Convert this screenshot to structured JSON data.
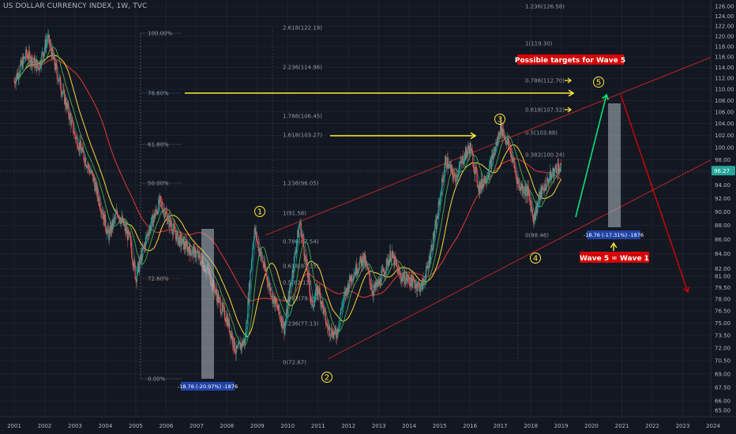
{
  "header": {
    "title": "US DOLLAR CURRENCY INDEX, 1W, TVC"
  },
  "chart_data": {
    "type": "candlestick",
    "title": "US DOLLAR CURRENCY INDEX, 1W, TVC",
    "x_ticks": [
      "2001",
      "2002",
      "2003",
      "2004",
      "2005",
      "2006",
      "2007",
      "2008",
      "2009",
      "2010",
      "2011",
      "2012",
      "2013",
      "2014",
      "2015",
      "2016",
      "2017",
      "2018",
      "2019",
      "2020",
      "2021",
      "2022",
      "2023",
      "2024"
    ],
    "y_ticks": [
      "126.00",
      "124.00",
      "122.00",
      "120.00",
      "118.00",
      "116.00",
      "114.00",
      "112.00",
      "110.00",
      "108.00",
      "106.00",
      "104.00",
      "102.00",
      "100.00",
      "98.00",
      "96.00",
      "94.00",
      "92.00",
      "90.00",
      "88.00",
      "86.00",
      "84.00",
      "82.00",
      "81.00",
      "79.50",
      "78.00",
      "76.50",
      "75.00",
      "73.50",
      "72.00",
      "70.50",
      "69.00",
      "67.50",
      "66.00",
      "65.00"
    ],
    "y_scale": "log",
    "ylim": [
      64.5,
      127
    ],
    "current_price": "96.27",
    "price_series": [
      [
        2001.0,
        111.5
      ],
      [
        2001.4,
        116.5
      ],
      [
        2001.8,
        114
      ],
      [
        2002.1,
        119.8
      ],
      [
        2002.4,
        113
      ],
      [
        2002.7,
        107.5
      ],
      [
        2003.0,
        102
      ],
      [
        2003.3,
        98.5
      ],
      [
        2003.6,
        95
      ],
      [
        2003.9,
        90
      ],
      [
        2004.1,
        86.5
      ],
      [
        2004.4,
        90
      ],
      [
        2004.8,
        86
      ],
      [
        2005.0,
        80.8
      ],
      [
        2005.4,
        87
      ],
      [
        2005.8,
        91.5
      ],
      [
        2006.0,
        89.5
      ],
      [
        2006.4,
        86
      ],
      [
        2006.8,
        84.5
      ],
      [
        2007.0,
        84
      ],
      [
        2007.4,
        81.5
      ],
      [
        2007.8,
        77
      ],
      [
        2008.0,
        75.5
      ],
      [
        2008.3,
        71.5
      ],
      [
        2008.6,
        73
      ],
      [
        2008.9,
        87.5
      ],
      [
        2009.1,
        84
      ],
      [
        2009.4,
        79.5
      ],
      [
        2009.9,
        74.3
      ],
      [
        2010.1,
        80
      ],
      [
        2010.4,
        88.5
      ],
      [
        2010.8,
        77
      ],
      [
        2011.0,
        79.5
      ],
      [
        2011.3,
        74.5
      ],
      [
        2011.6,
        73.5
      ],
      [
        2011.8,
        77.5
      ],
      [
        2012.1,
        81
      ],
      [
        2012.5,
        83.5
      ],
      [
        2012.8,
        79
      ],
      [
        2013.0,
        80
      ],
      [
        2013.4,
        84
      ],
      [
        2013.7,
        81
      ],
      [
        2014.0,
        80.5
      ],
      [
        2014.4,
        79.5
      ],
      [
        2014.6,
        82
      ],
      [
        2014.9,
        88.5
      ],
      [
        2015.2,
        98
      ],
      [
        2015.5,
        95
      ],
      [
        2015.8,
        98.5
      ],
      [
        2016.0,
        100
      ],
      [
        2016.3,
        93.5
      ],
      [
        2016.6,
        96
      ],
      [
        2016.9,
        101
      ],
      [
        2017.0,
        103.5
      ],
      [
        2017.3,
        100
      ],
      [
        2017.6,
        94
      ],
      [
        2017.9,
        93
      ],
      [
        2018.1,
        89
      ],
      [
        2018.3,
        92.5
      ],
      [
        2018.6,
        95
      ],
      [
        2018.9,
        97
      ],
      [
        2019.0,
        96.3
      ]
    ],
    "fib_retracement_left": [
      {
        "label": "100.00%"
      },
      {
        "label": "78.60%"
      },
      {
        "label": "61.80%"
      },
      {
        "label": "50.00%"
      },
      {
        "label": "72.60%"
      },
      {
        "label": "0.00%"
      }
    ],
    "fib_extension_mid": [
      {
        "label": "2.618(122.19)"
      },
      {
        "label": "2.236(114.96)"
      },
      {
        "label": "1.786(106.45)"
      },
      {
        "label": "1.618(103.27)"
      },
      {
        "label": "1.236(96.05)"
      },
      {
        "label": "1(91.58)"
      },
      {
        "label": "0.786(87.54)"
      },
      {
        "label": "0.618(84.35)"
      },
      {
        "label": "0.5(82.12)"
      },
      {
        "label": "0.382(79.89)"
      },
      {
        "label": "0.236(77.13)"
      },
      {
        "label": "0(72.67)"
      }
    ],
    "fib_extension_right": [
      {
        "label": "1.236(126.58)"
      },
      {
        "label": "1(119.30)"
      },
      {
        "label": "0.786(112.70)"
      },
      {
        "label": "0.618(107.52)"
      },
      {
        "label": "0.5(103.88)"
      },
      {
        "label": "0.382(100.24)"
      },
      {
        "label": "0(88.46)"
      }
    ],
    "wave_labels": [
      "1",
      "2",
      "3",
      "4",
      "5"
    ],
    "annotations": {
      "targets": "Possible targets for Wave 5",
      "wave_equal": "Wave 5 = Wave 1",
      "measure_left": "-18.76 (-20.97%) -1876",
      "measure_right": "-18.76 (-17.31%) -1876"
    },
    "colors": {
      "background": "#131722",
      "channel": "#c62828",
      "arrow_yellow": "#ffeb3b",
      "arrow_green": "#00e676",
      "arrow_red": "#d50000",
      "ma_red": "#e53935",
      "ma_yellow": "#fdd835",
      "ma_green": "#43a047",
      "up_candle": "#26a69a",
      "down_candle": "#ef5350"
    }
  }
}
